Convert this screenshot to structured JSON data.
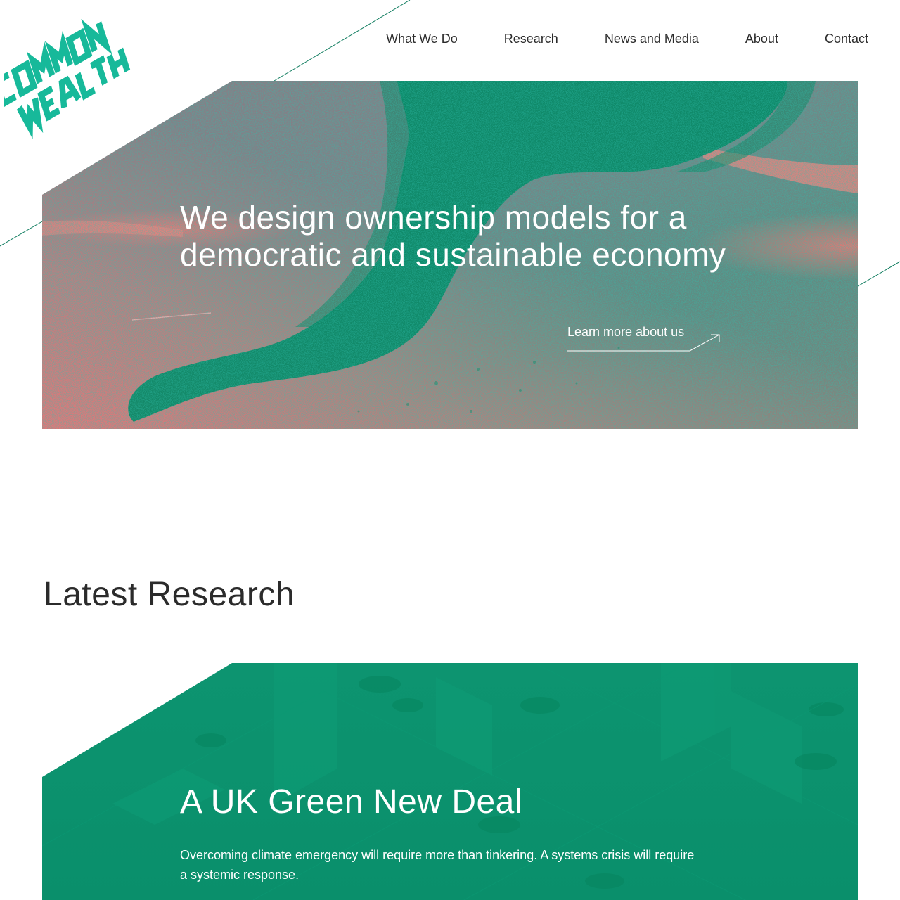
{
  "brand": {
    "logo_alt": "Common Wealth",
    "logo_line1": "COMMON",
    "logo_line2": "WEALTH",
    "color": "#17b99a"
  },
  "nav": {
    "items": [
      {
        "label": "What We Do"
      },
      {
        "label": "Research"
      },
      {
        "label": "News and Media"
      },
      {
        "label": "About"
      },
      {
        "label": "Contact"
      }
    ]
  },
  "hero": {
    "title": "We design ownership models for a democratic and sustainable economy",
    "link_label": "Learn more about us"
  },
  "latest_research": {
    "title": "Latest Research",
    "card": {
      "title": "A UK Green New Deal",
      "description": "Overcoming climate emergency will require more than tinkering. A systems crisis will require a systemic response.",
      "color": "#0a8f6b"
    }
  },
  "colors": {
    "accent": "#0a8f6b",
    "text": "#2b2b2b",
    "line": "#0b7a5c"
  }
}
